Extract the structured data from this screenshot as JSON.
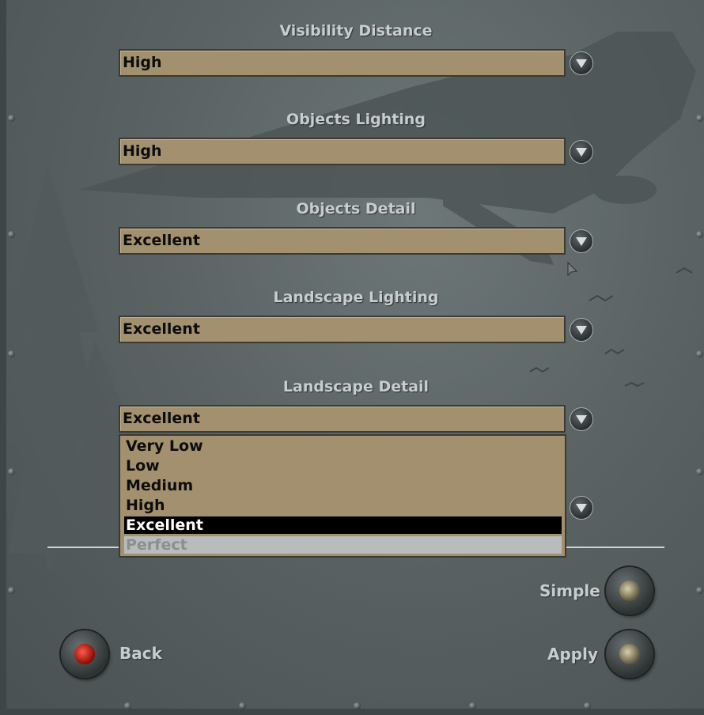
{
  "settings": [
    {
      "label": "Visibility Distance",
      "value": "High"
    },
    {
      "label": "Objects Lighting",
      "value": "High"
    },
    {
      "label": "Objects Detail",
      "value": "Excellent"
    },
    {
      "label": "Landscape Lighting",
      "value": "Excellent"
    },
    {
      "label": "Landscape Detail",
      "value": "Excellent"
    }
  ],
  "dropdown": {
    "options": [
      "Very Low",
      "Low",
      "Medium",
      "High",
      "Excellent",
      "Perfect"
    ],
    "selected": "Excellent",
    "disabled": "Perfect"
  },
  "buttons": {
    "simple": "Simple",
    "back": "Back",
    "apply": "Apply"
  },
  "colors": {
    "field_bg": "#a3906f",
    "label_text": "#c8cdce",
    "back_lamp": "#d81f14"
  }
}
